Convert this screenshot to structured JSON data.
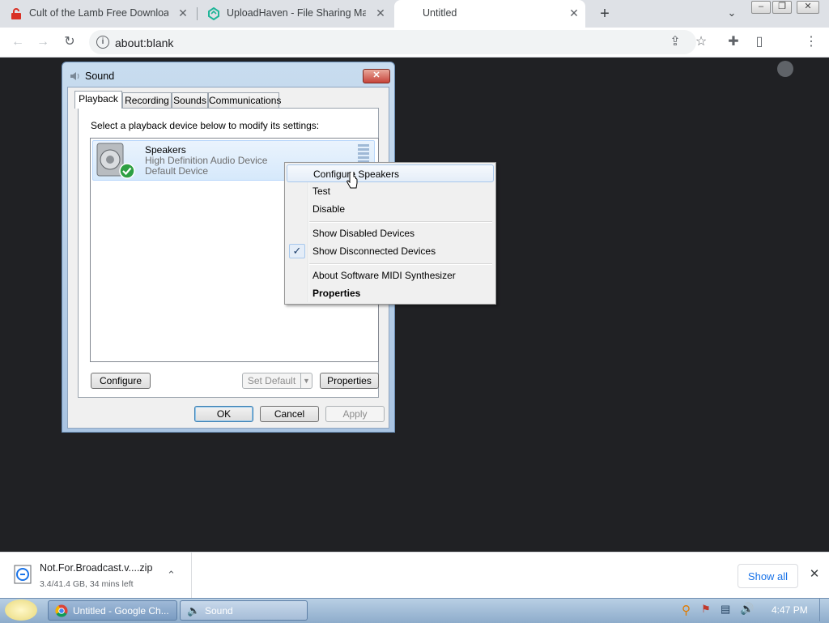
{
  "browser": {
    "tabs": [
      {
        "title": "Cult of the Lamb Free Download",
        "icon": "lock-icon-red"
      },
      {
        "title": "UploadHaven - File Sharing Made",
        "icon": "uploadhaven-icon"
      },
      {
        "title": "Untitled",
        "icon": ""
      }
    ],
    "url": "about:blank"
  },
  "dialog": {
    "title": "Sound",
    "tabs": [
      "Playback",
      "Recording",
      "Sounds",
      "Communications"
    ],
    "instruction": "Select a playback device below to modify its settings:",
    "device": {
      "name": "Speakers",
      "description": "High Definition Audio Device",
      "status": "Default Device"
    },
    "buttons": {
      "configure": "Configure",
      "set_default": "Set Default",
      "properties": "Properties",
      "ok": "OK",
      "cancel": "Cancel",
      "apply": "Apply"
    }
  },
  "context_menu": {
    "items": [
      {
        "label": "Configure Speakers",
        "checked": false,
        "bold": false,
        "highlighted": true
      },
      {
        "label": "Test",
        "checked": false,
        "bold": false
      },
      {
        "label": "Disable",
        "checked": false,
        "bold": false
      },
      {
        "label": "Show Disabled Devices",
        "checked": false,
        "bold": false
      },
      {
        "label": "Show Disconnected Devices",
        "checked": true,
        "bold": false
      },
      {
        "label": "About Software MIDI Synthesizer",
        "checked": false,
        "bold": false
      },
      {
        "label": "Properties",
        "checked": false,
        "bold": true
      }
    ]
  },
  "download": {
    "filename": "Not.For.Broadcast.v....zip",
    "progress": "3.4/41.4 GB, 34 mins left",
    "show_all": "Show all"
  },
  "taskbar": {
    "items": [
      "Untitled - Google Ch...",
      "Sound"
    ],
    "clock": "4:47 PM"
  },
  "colors": {
    "page_bg": "#202124",
    "accent": "#1a73e8"
  }
}
